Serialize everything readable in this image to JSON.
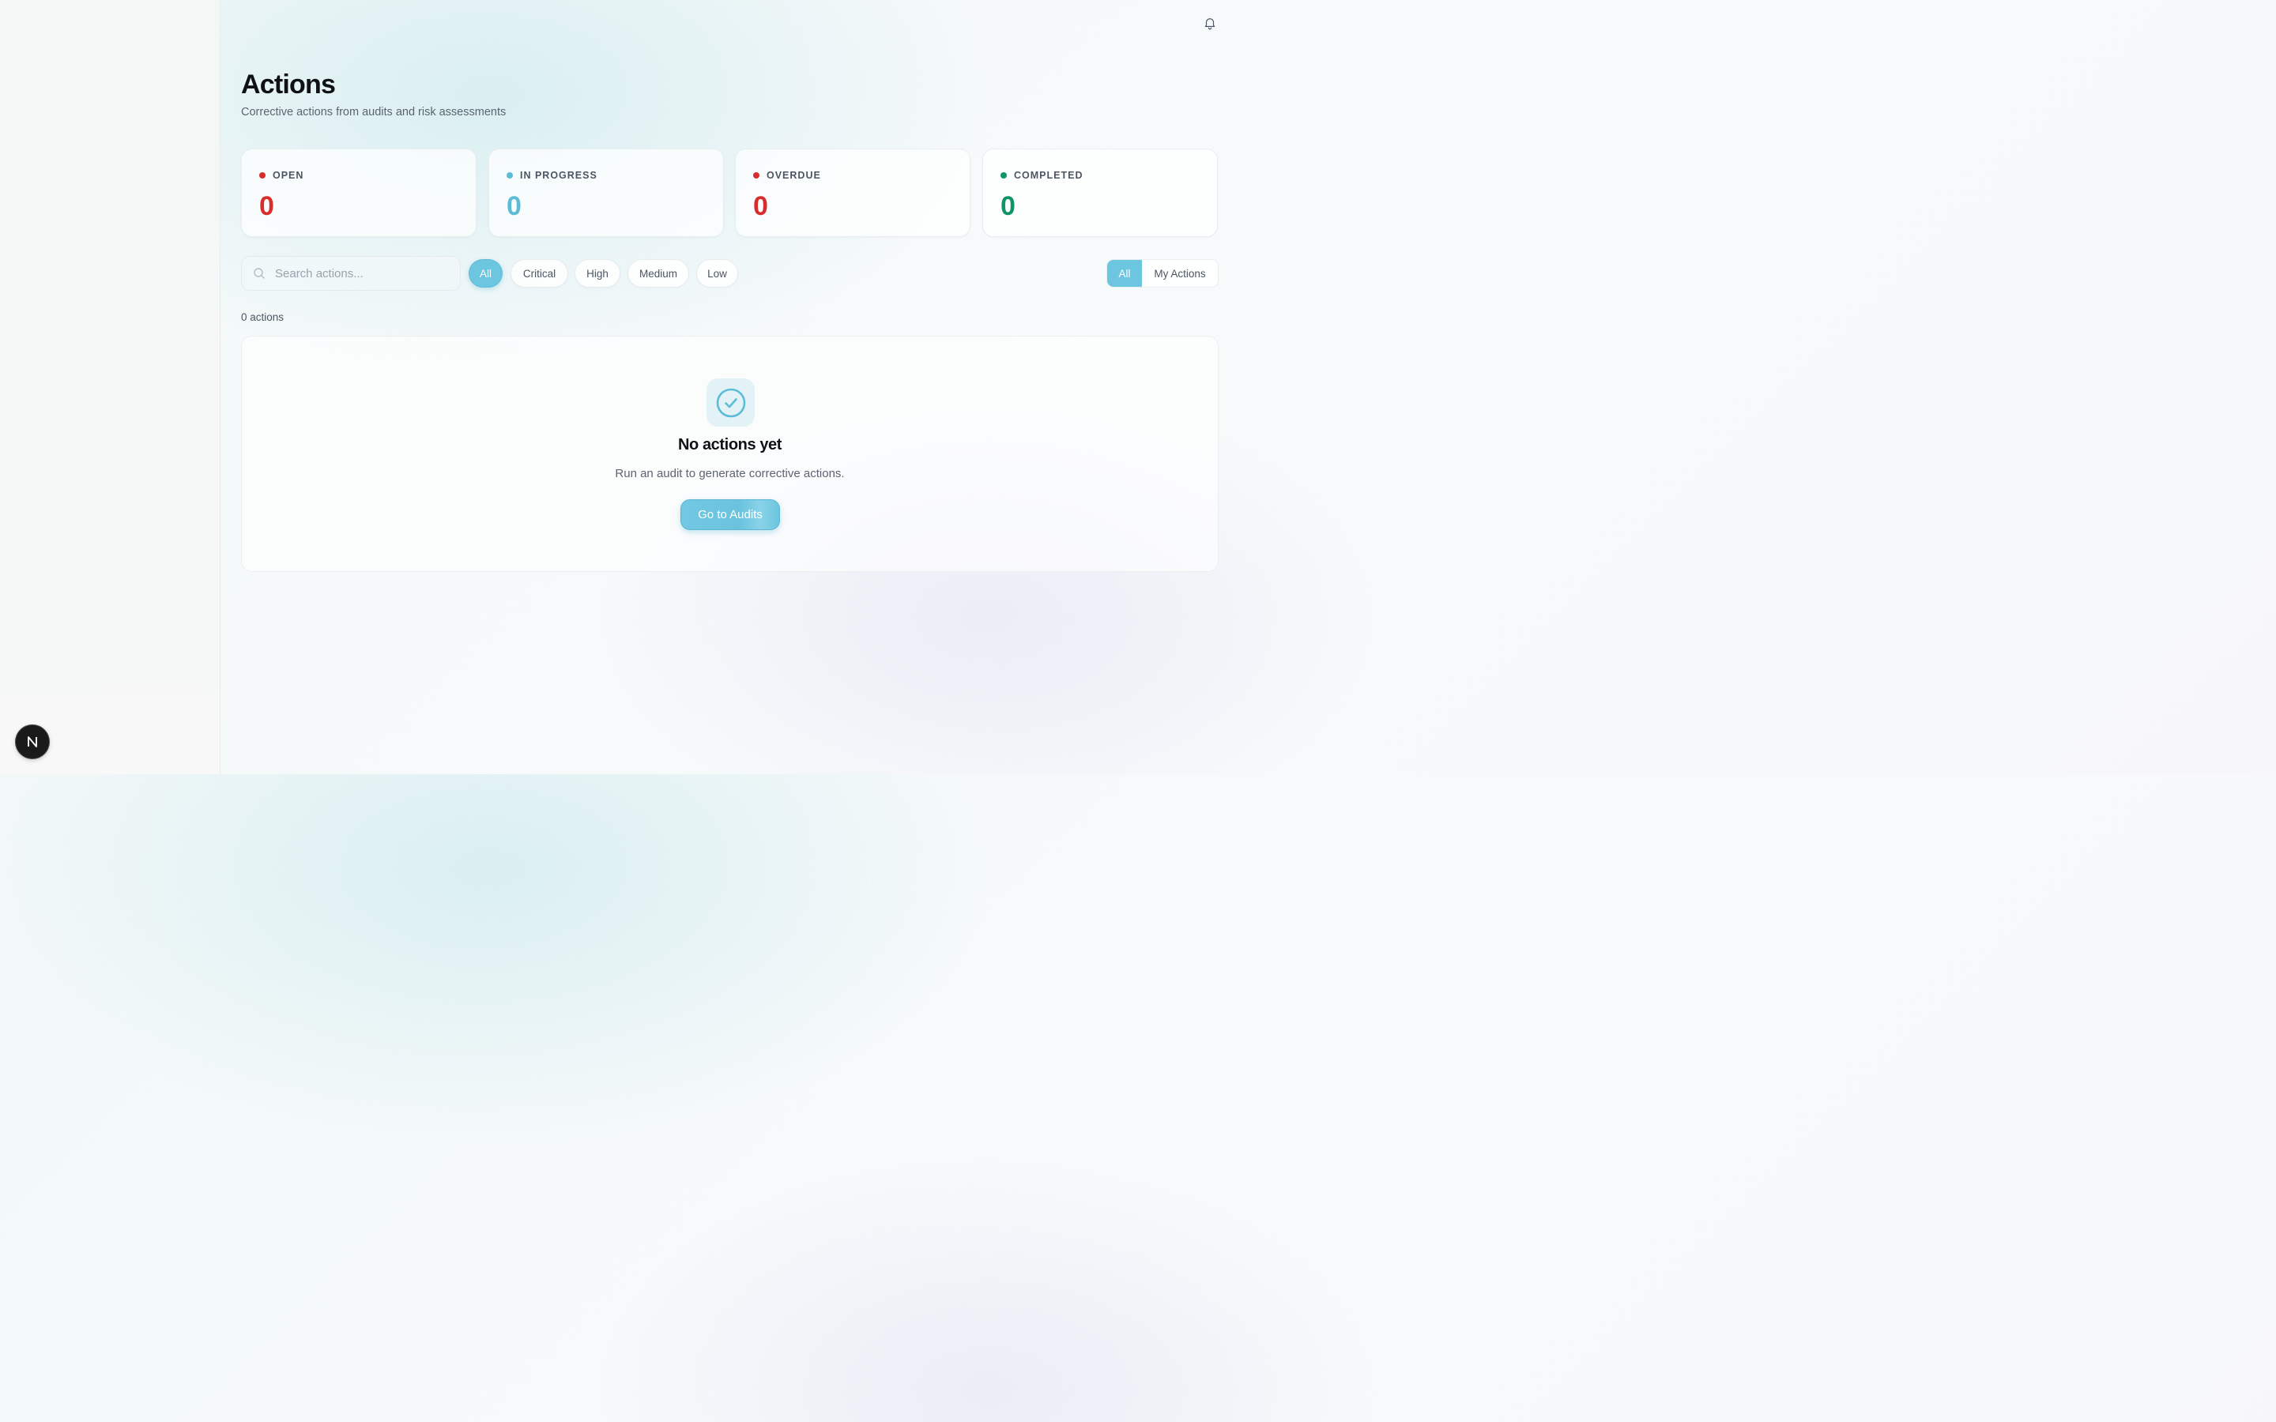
{
  "header": {
    "notifications_icon": "bell-icon"
  },
  "page": {
    "title": "Actions",
    "subtitle": "Corrective actions from audits and risk assessments"
  },
  "stats": [
    {
      "label": "OPEN",
      "value": "0",
      "color": "#d92d2d"
    },
    {
      "label": "IN PROGRESS",
      "value": "0",
      "color": "#5bbcd8"
    },
    {
      "label": "OVERDUE",
      "value": "0",
      "color": "#d92d2d"
    },
    {
      "label": "COMPLETED",
      "value": "0",
      "color": "#0f9466"
    }
  ],
  "filters": {
    "search_placeholder": "Search actions...",
    "severity": [
      "All",
      "Critical",
      "High",
      "Medium",
      "Low"
    ],
    "severity_selected": "All",
    "scope": [
      "All",
      "My Actions"
    ],
    "scope_selected": "All"
  },
  "list": {
    "count_text": "0 actions"
  },
  "empty_state": {
    "icon": "check-circle-icon",
    "title": "No actions yet",
    "description": "Run an audit to generate corrective actions.",
    "button_label": "Go to Audits"
  },
  "badge": {
    "letter": "N"
  },
  "colors": {
    "accent": "#6cc6e0",
    "danger": "#d92d2d",
    "success": "#0f9466"
  }
}
